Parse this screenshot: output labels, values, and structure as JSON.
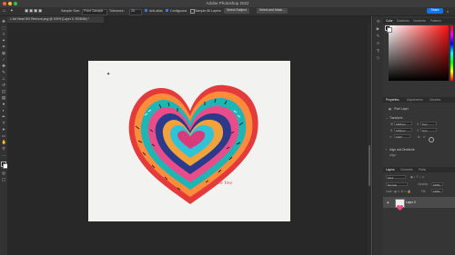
{
  "window": {
    "title": "Adobe Photoshop 2022",
    "traffic_lights": [
      "#ff5f57",
      "#febc2e",
      "#28c840"
    ]
  },
  "options_bar": {
    "sample_size_label": "Sample Size:",
    "sample_size_value": "Point Sample",
    "tolerance_label": "Tolerance:",
    "tolerance_value": "25",
    "anti_alias": "Anti-alias",
    "contiguous": "Contiguous",
    "sample_all_layers": "Sample All Layers",
    "select_subject": "Select Subject",
    "select_and_mask": "Select and Mask...",
    "share": "Share"
  },
  "document": {
    "tab_label": "Art Heart BG Remove.png @ 100% (Layer 0, RGB/8#) *",
    "signature": "Elle Vee"
  },
  "panels": {
    "color_tabs": [
      "Color",
      "Swatches",
      "Gradients",
      "Patterns"
    ],
    "properties_tabs": [
      "Properties",
      "Adjustments",
      "Libraries"
    ],
    "pixel_layer": "Pixel Layer",
    "transform": {
      "title": "Transform",
      "w": "1460 px",
      "x": "0 px",
      "h": "1162 px",
      "y": "0 px",
      "angle": "0.00°"
    },
    "align_title": "Align and Distribute",
    "align_sub": "Align:",
    "layers_tabs": [
      "Layers",
      "Channels",
      "Paths"
    ],
    "kind": "Kind",
    "blend_mode": "Normal",
    "opacity_label": "Opacity:",
    "opacity": "100%",
    "lock_label": "Lock:",
    "fill_label": "Fill:",
    "fill": "100%",
    "layer_name": "Layer 0"
  },
  "accent": "#1473e6"
}
